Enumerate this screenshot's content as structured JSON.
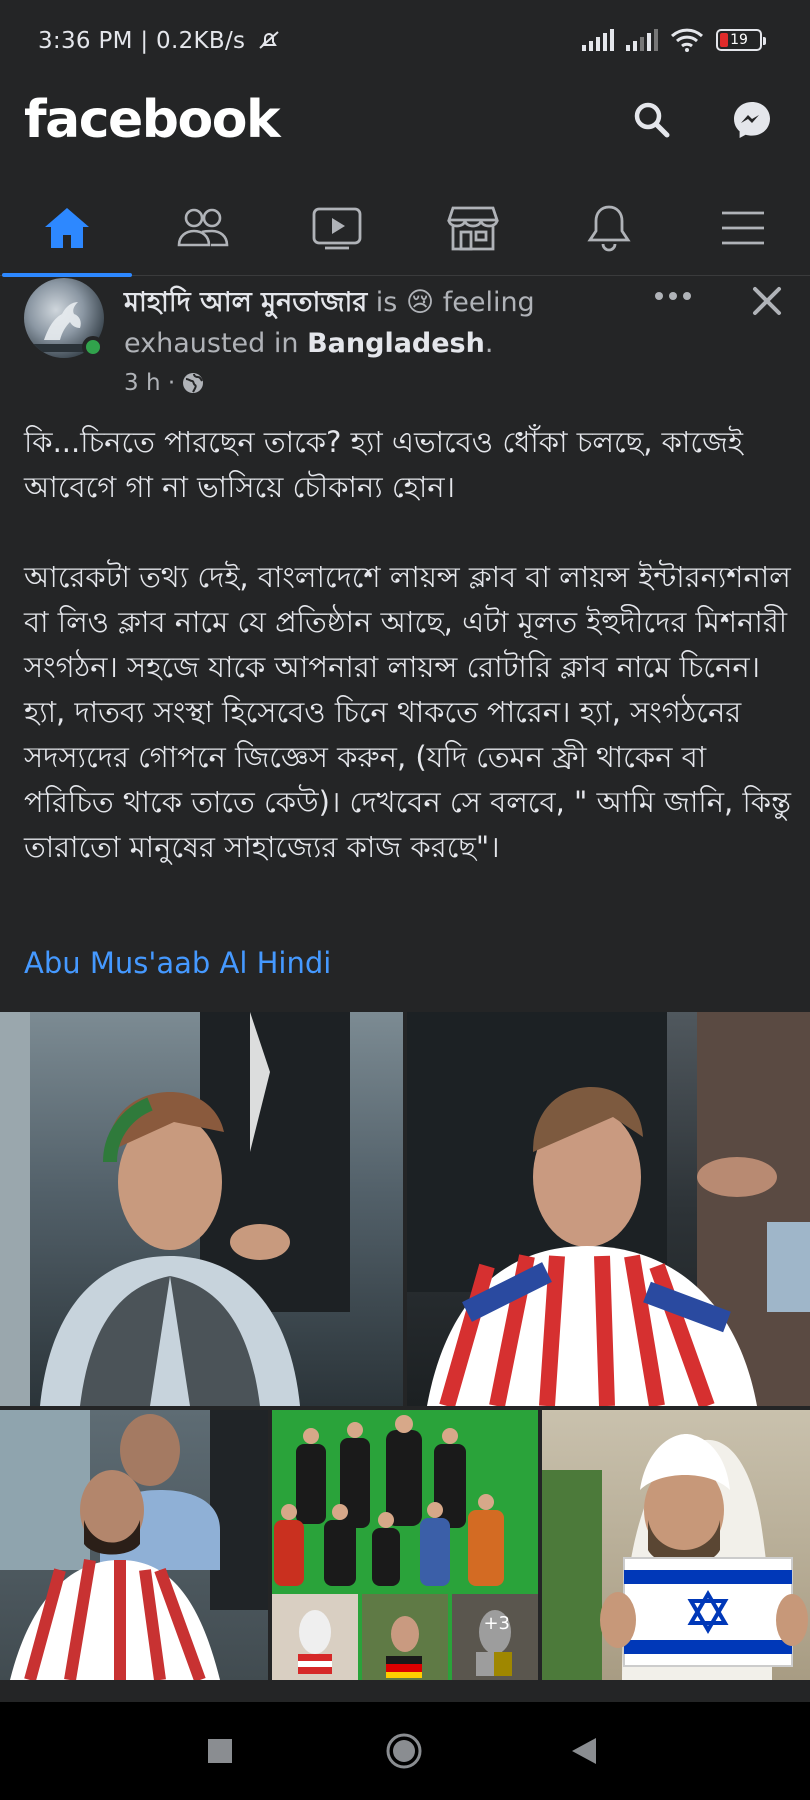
{
  "status_bar": {
    "time": "3:36 PM | 0.2KB/s",
    "battery": "19",
    "battery_color": "#e02b2b"
  },
  "app_bar": {
    "logo": "facebook",
    "search_icon": "search-icon",
    "messenger_icon": "messenger-icon"
  },
  "tabs": [
    {
      "icon": "home-icon",
      "active": true
    },
    {
      "icon": "friends-icon",
      "active": false
    },
    {
      "icon": "watch-icon",
      "active": false
    },
    {
      "icon": "marketplace-icon",
      "active": false
    },
    {
      "icon": "notifications-icon",
      "active": false
    },
    {
      "icon": "menu-icon",
      "active": false
    }
  ],
  "post": {
    "author": "মাহাদি আল মুনতাজার",
    "is_text": "is",
    "feeling_emoji": "😢",
    "feeling_text": "feeling exhausted in",
    "location": "Bangladesh",
    "time": "3 h ·",
    "paragraph_1": "কি...চিনতে পারছেন তাকে? হ্যা এভাবেও ধোঁকা চলছে, কাজেই আবেগে গা না ভাসিয়ে চৌকান্য হোন।",
    "paragraph_2": "আরেকটা তথ্য দেই, বাংলাদেশে লায়ন্স ক্লাব বা লায়ন্স ইন্টারন্যশনাল বা লিও ক্লাব নামে যে প্রতিষ্ঠান আছে, এটা মূলত ইহুদীদের মিশনারী সংগঠন। সহজে যাকে আপনারা লায়ন্স রোটারি ক্লাব নামে চিনেন। হ্যা, দাতব্য সংস্থা হিসেবেও চিনে থাকতে পারেন। হ্যা, সংগঠনের সদস্যদের গোপনে জিজ্ঞেস করুন, (যদি তেমন ফ্রী থাকেন বা পরিচিত থাকে তাতে কেউ)। দেখবেন সে বলবে,  \" আমি জানি, কিন্তু তারাতো মানুষের সাহাজ্যের কাজ করছে\"।",
    "tagged_user": "Abu Mus'aab Al Hindi",
    "more_photos": "+3",
    "link_color": "#4599ff"
  },
  "accent_color": "#2d88ff",
  "nav_bar": {
    "recents_icon": "square-icon",
    "home_icon": "circle-icon",
    "back_icon": "back-triangle-icon"
  }
}
